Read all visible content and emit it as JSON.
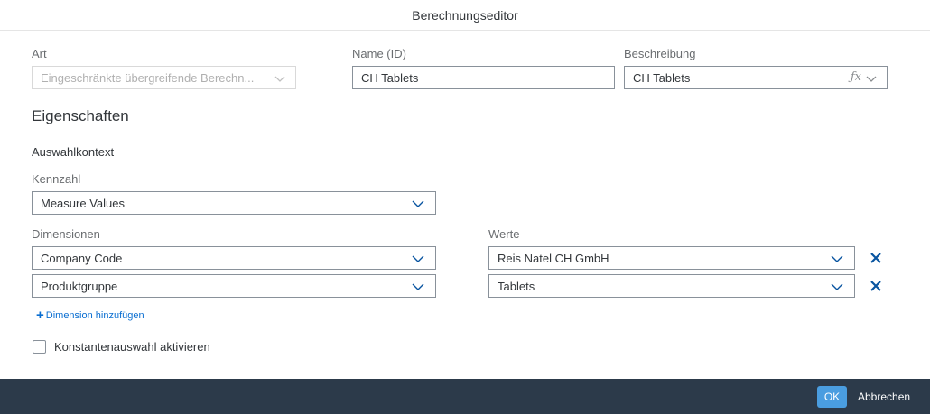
{
  "dialog": {
    "title": "Berechnungseditor"
  },
  "top_fields": {
    "art": {
      "label": "Art",
      "value": "Eingeschränkte übergreifende Berechn..."
    },
    "name": {
      "label": "Name (ID)",
      "value": "CH Tablets"
    },
    "beschreibung": {
      "label": "Beschreibung",
      "value": "CH Tablets",
      "formula_icon_text": "ƒx"
    }
  },
  "properties": {
    "title": "Eigenschaften",
    "context_label": "Auswahlkontext",
    "kennzahl": {
      "label": "Kennzahl",
      "value": "Measure Values"
    },
    "dimensions_label": "Dimensionen",
    "values_label": "Werte",
    "dimensions": [
      {
        "dimension": "Company Code",
        "value": "Reis Natel CH GmbH"
      },
      {
        "dimension": "Produktgruppe",
        "value": "Tablets"
      }
    ],
    "add_dimension_label": "Dimension hinzufügen",
    "constant_selection_label": "Konstantenauswahl aktivieren",
    "constant_selection_checked": false
  },
  "footer": {
    "ok_label": "OK",
    "cancel_label": "Abbrechen"
  },
  "colors": {
    "footer_bg": "#2c3a4a",
    "accent": "#0a6ed1",
    "ok_bg": "#4a9de0",
    "remove_icon": "#0854a0"
  }
}
